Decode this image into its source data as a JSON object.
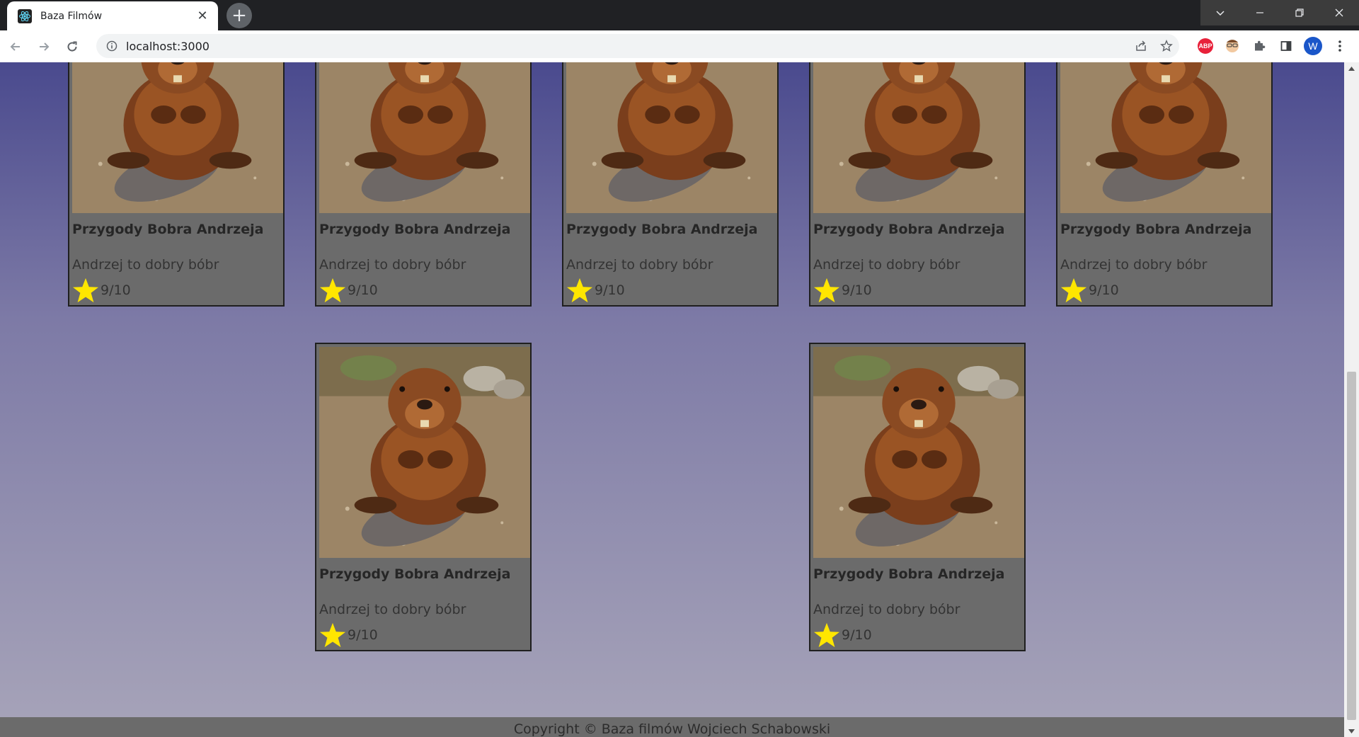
{
  "browser": {
    "tab_title": "Baza Filmów",
    "url": "localhost:3000",
    "profile_initial": "W",
    "abp_label": "ABP",
    "new_tab_symbol": "+",
    "close_symbol": "✕"
  },
  "movies": [
    {
      "title": "Przygody Bobra Andrzeja",
      "description": "Andrzej to dobry bóbr",
      "rating": "9/10"
    },
    {
      "title": "Przygody Bobra Andrzeja",
      "description": "Andrzej to dobry bóbr",
      "rating": "9/10"
    },
    {
      "title": "Przygody Bobra Andrzeja",
      "description": "Andrzej to dobry bóbr",
      "rating": "9/10"
    },
    {
      "title": "Przygody Bobra Andrzeja",
      "description": "Andrzej to dobry bóbr",
      "rating": "9/10"
    },
    {
      "title": "Przygody Bobra Andrzeja",
      "description": "Andrzej to dobry bóbr",
      "rating": "9/10"
    },
    {
      "title": "Przygody Bobra Andrzeja",
      "description": "Andrzej to dobry bóbr",
      "rating": "9/10"
    },
    {
      "title": "Przygody Bobra Andrzeja",
      "description": "Andrzej to dobry bóbr",
      "rating": "9/10"
    }
  ],
  "footer": {
    "copyright": "Copyright © Baza filmów Wojciech Schabowski"
  },
  "icons": {
    "rating": "star-icon",
    "poster": "beaver-image"
  },
  "colors": {
    "card_bg": "#6b6b6b",
    "star": "#ffe600",
    "page_gradient_top": "#4a4a8e",
    "page_gradient_bottom": "#a7a4b9"
  }
}
